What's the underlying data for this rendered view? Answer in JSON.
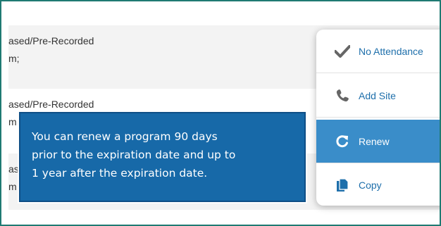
{
  "rows": [
    {
      "line1": "ased/Pre-Recorded",
      "line2": "m;"
    },
    {
      "line1": "ased/Pre-Recorded",
      "line2": "m"
    },
    {
      "line1": "as",
      "line2": "m"
    }
  ],
  "menu": {
    "items": [
      {
        "label": "No Attendance",
        "icon": "check-icon",
        "active": false
      },
      {
        "label": "Add Site",
        "icon": "phone-icon",
        "active": false
      },
      {
        "label": "Renew",
        "icon": "refresh-icon",
        "active": true
      },
      {
        "label": "Copy",
        "icon": "copy-icon",
        "active": false
      }
    ]
  },
  "tooltip": {
    "lines": [
      "You can renew a program 90 days",
      "prior to the expiration date and up to",
      "1 year after the expiration date."
    ]
  },
  "colors": {
    "frame_border": "#1f7a72",
    "menu_text": "#1e6fab",
    "menu_active_bg": "#3a8dc9",
    "tooltip_bg": "#1769a8"
  }
}
